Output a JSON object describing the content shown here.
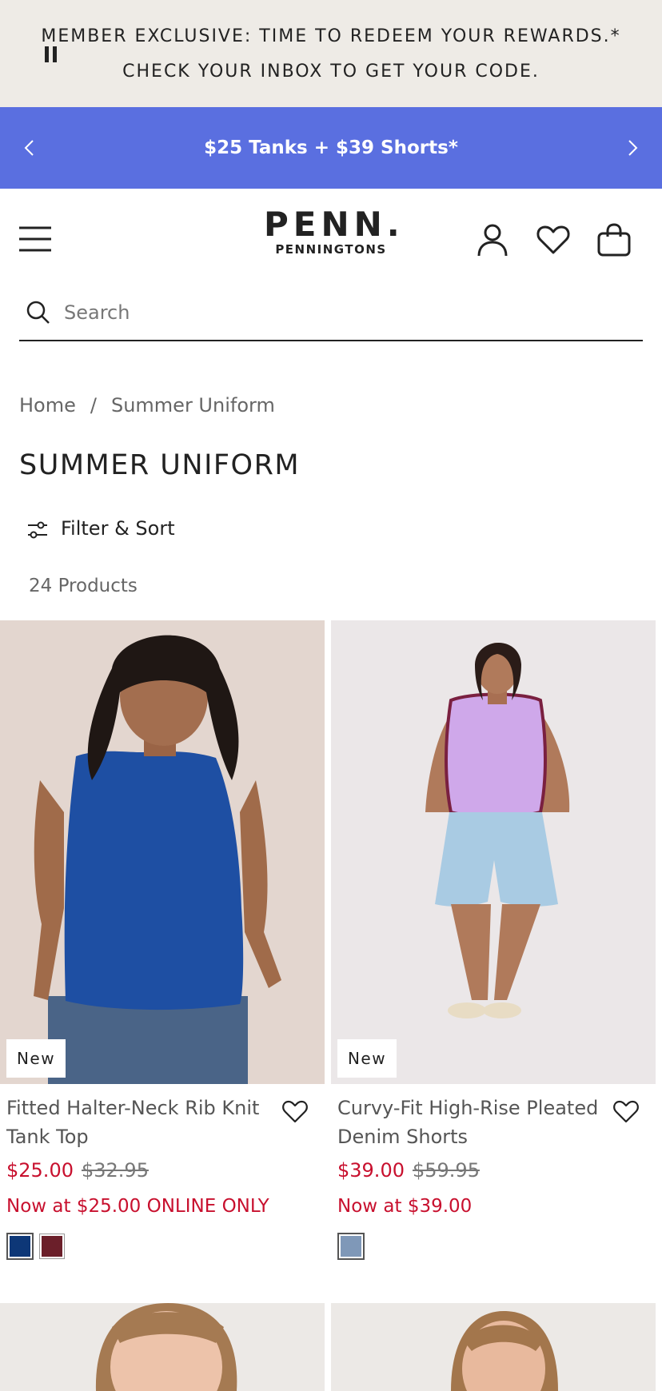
{
  "promo": {
    "line1": "MEMBER EXCLUSIVE: TIME TO REDEEM YOUR REWARDS.*",
    "line2": "CHECK YOUR INBOX TO GET YOUR CODE."
  },
  "banner": {
    "text": "$25 Tanks + $39 Shorts*",
    "color": "#5a6fe0"
  },
  "logo": {
    "big": "PENN.",
    "small": "PENNINGTONS"
  },
  "search": {
    "placeholder": "Search"
  },
  "breadcrumb": {
    "home": "Home",
    "separator": "/",
    "current": "Summer Uniform"
  },
  "page_title": "SUMMER UNIFORM",
  "filter": {
    "label": "Filter & Sort"
  },
  "product_count": "24 Products",
  "products": [
    {
      "badge": "New",
      "name": "Fitted Halter-Neck Rib Knit Tank Top",
      "price": "$25.00",
      "original_price": "$32.95",
      "promo": "Now at $25.00 ONLINE ONLY",
      "swatches": [
        "#0d3777",
        "#6b1f2a"
      ]
    },
    {
      "badge": "New",
      "name": "Curvy-Fit High-Rise Pleated Denim Shorts",
      "price": "$39.00",
      "original_price": "$59.95",
      "promo": "Now at $39.00",
      "swatches": [
        "#7f98b8"
      ]
    }
  ],
  "colors": {
    "sale_red": "#c8102e",
    "promo_bg": "#eeebe6"
  }
}
